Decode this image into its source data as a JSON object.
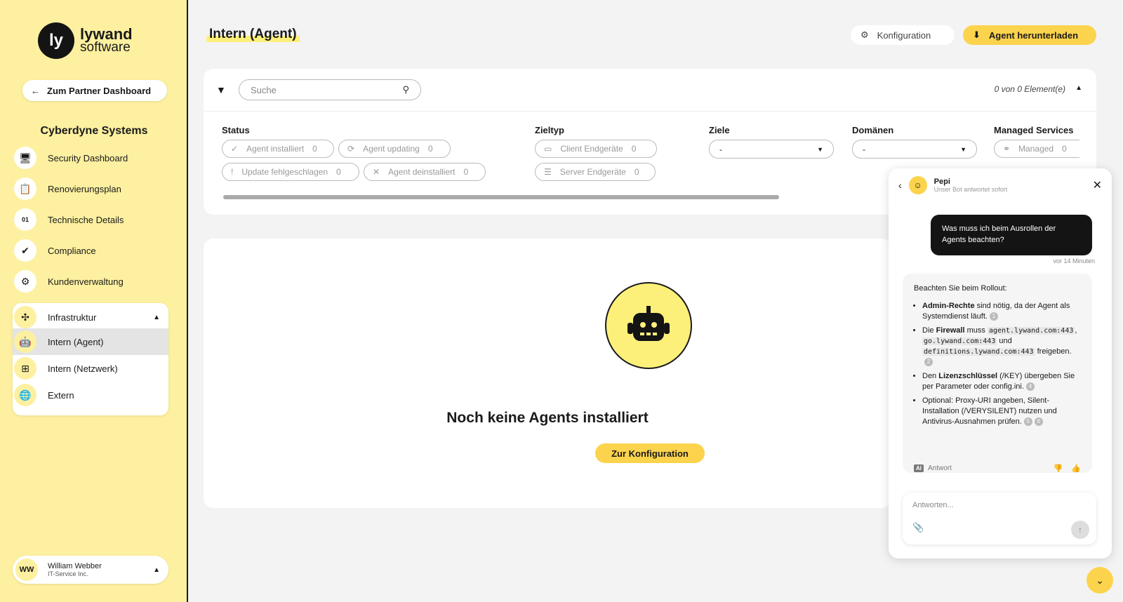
{
  "brand": {
    "mark": "ly",
    "name": "lywand",
    "sub": "software"
  },
  "sidebar": {
    "partner_button": "Zum Partner Dashboard",
    "company": "Cyberdyne Systems",
    "items": [
      {
        "label": "Security Dashboard",
        "icon": "monitor-icon"
      },
      {
        "label": "Renovierungsplan",
        "icon": "clipboard-icon"
      },
      {
        "label": "Technische Details",
        "icon": "binary-icon"
      },
      {
        "label": "Compliance",
        "icon": "check-badge-icon"
      },
      {
        "label": "Kundenverwaltung",
        "icon": "gears-icon"
      }
    ],
    "group": {
      "label": "Infrastruktur",
      "items": [
        {
          "label": "Intern (Agent)"
        },
        {
          "label": "Intern (Netzwerk)"
        },
        {
          "label": "Extern"
        }
      ]
    },
    "user": {
      "initials": "WW",
      "name": "William Webber",
      "org": "IT-Service Inc."
    }
  },
  "header": {
    "title": "Intern (Agent)",
    "config_button": "Konfiguration",
    "download_button": "Agent herunterladen"
  },
  "filters": {
    "search_placeholder": "Suche",
    "count": "0 von 0 Element(e)",
    "status": {
      "title": "Status",
      "chips": [
        {
          "label": "Agent installiert",
          "count": "0"
        },
        {
          "label": "Agent updating",
          "count": "0"
        },
        {
          "label": "Update fehlgeschlagen",
          "count": "0"
        },
        {
          "label": "Agent deinstalliert",
          "count": "0"
        }
      ]
    },
    "zieltyp": {
      "title": "Zieltyp",
      "chips": [
        {
          "label": "Client Endgeräte",
          "count": "0"
        },
        {
          "label": "Server Endgeräte",
          "count": "0"
        }
      ]
    },
    "ziele": {
      "title": "Ziele",
      "value": "-"
    },
    "domaenen": {
      "title": "Domänen",
      "value": "-"
    },
    "managed": {
      "title": "Managed Services",
      "chip_label": "Managed",
      "count": "0"
    }
  },
  "empty": {
    "title": "Noch keine Agents installiert",
    "button": "Zur Konfiguration"
  },
  "chat": {
    "bot_name": "Pepi",
    "bot_sub": "Unser Bot antwortet sofort",
    "user_message": "Was muss ich beim Ausrollen der Agents beachten?",
    "user_time": "vor 14 Minuten",
    "intro": "Beachten Sie beim Rollout:",
    "b1_bold": "Admin-Rechte",
    "b1_text": "sind nötig, da der Agent als Systemdienst läuft.",
    "b1_cite": "1",
    "b2_pre": "Die",
    "b2_bold": "Firewall",
    "b2_text": "muss",
    "b2_code1": "agent.lywand.com:443",
    "b2_code2": "go.lywand.com:443",
    "b2_und": "und",
    "b2_code3": "definitions.lywand.com:443",
    "b2_end": "freigeben.",
    "b2_cite": "2",
    "b3_pre": "Den",
    "b3_bold": "Lizenzschlüssel",
    "b3_text": "(/KEY) übergeben Sie per Parameter oder config.ini.",
    "b3_cite": "4",
    "b4_text": "Optional: Proxy-URI angeben, Silent-Installation (/VERYSILENT) nutzen und Antivirus-Ausnahmen prüfen.",
    "b4_cite1": "5",
    "b4_cite2": "6",
    "ai_tag": "AI",
    "answer_label": "Antwort",
    "input_placeholder": "Antworten..."
  },
  "colors": {
    "sidebar_bg": "#fdf0a0",
    "accent": "#fcd34d",
    "dark": "#141414"
  }
}
